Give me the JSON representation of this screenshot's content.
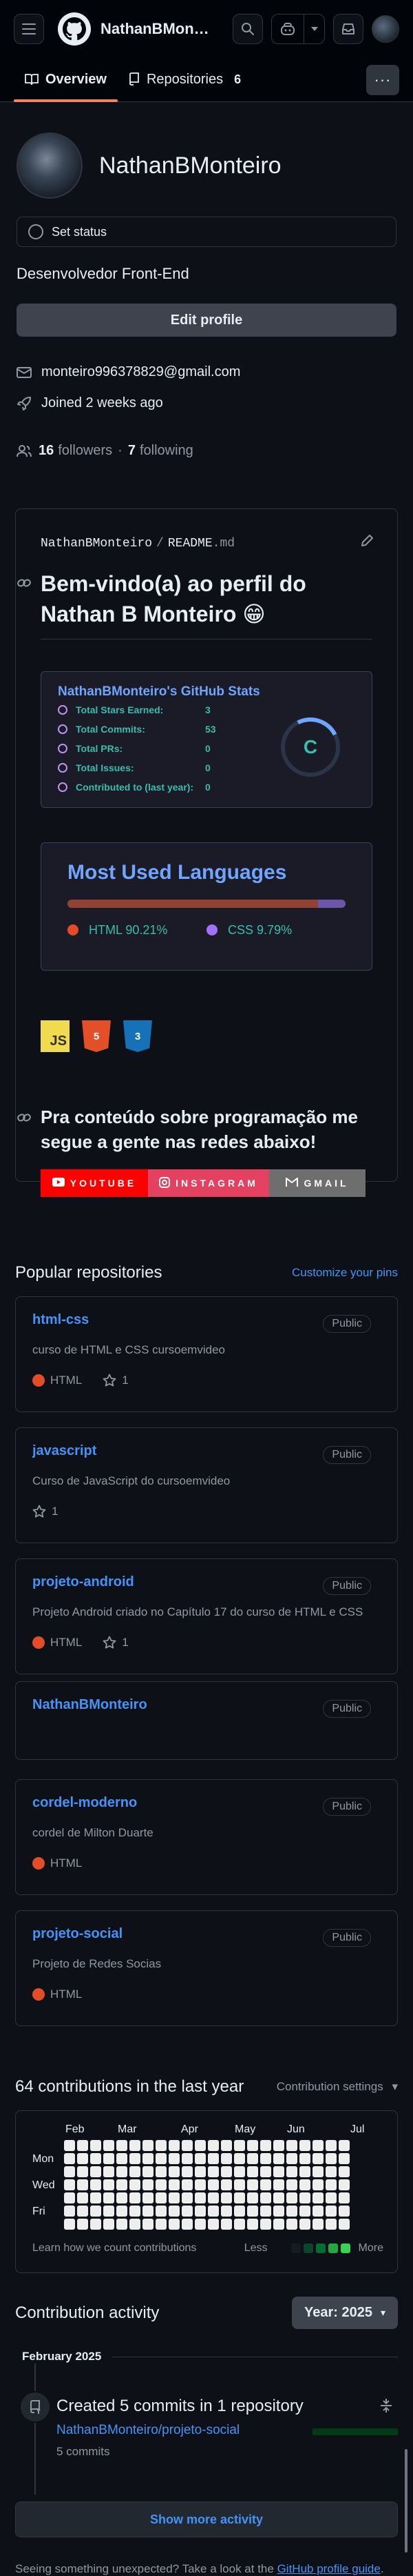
{
  "header": {
    "username": "NathanBMonteiro",
    "avatar_icon": "user-avatar"
  },
  "tabs": [
    {
      "label": "Overview"
    },
    {
      "label": "Repositories",
      "count": "6"
    }
  ],
  "profile": {
    "name": "NathanBMonteiro",
    "status_label": "Set status",
    "bio": "Desenvolvedor Front-End",
    "edit_label": "Edit profile",
    "email": "monteiro996378829@gmail.com",
    "joined": "Joined 2 weeks ago",
    "followers_count": "16",
    "followers_label": "followers",
    "separator": "·",
    "following_count": "7",
    "following_label": "following"
  },
  "readme": {
    "owner": "NathanBMonteiro",
    "slash": "/",
    "file": "README",
    "ext": ".md",
    "title": "Bem-vindo(a) ao perfil do Nathan B Monteiro 😁",
    "stats": {
      "title": "NathanBMonteiro's GitHub Stats",
      "rows": [
        {
          "label": "Total Stars Earned:",
          "value": "3"
        },
        {
          "label": "Total Commits:",
          "value": "53"
        },
        {
          "label": "Total PRs:",
          "value": "0"
        },
        {
          "label": "Total Issues:",
          "value": "0"
        },
        {
          "label": "Contributed to (last year):",
          "value": "0"
        }
      ],
      "rank": "C",
      "accent": "#70a5fd",
      "text_color": "#38bdae"
    },
    "languages": {
      "title": "Most Used Languages",
      "items": [
        {
          "name": "HTML",
          "percent": "90.21%",
          "value": 90.21,
          "color": "#e34c26"
        },
        {
          "name": "CSS",
          "percent": "9.79%",
          "value": 9.79,
          "color": "#a371f7"
        }
      ]
    },
    "tech": [
      {
        "label": "JS",
        "icon": "javascript-icon"
      },
      {
        "label": "5",
        "icon": "html5-icon"
      },
      {
        "label": "3",
        "icon": "css3-icon"
      }
    ],
    "social_title": "Pra conteúdo sobre programação me segue a gente nas redes abaixo!",
    "social": [
      {
        "label": "YOUTUBE",
        "icon": "youtube-icon"
      },
      {
        "label": "INSTAGRAM",
        "icon": "instagram-icon"
      },
      {
        "label": "GMAIL",
        "icon": "gmail-icon"
      }
    ]
  },
  "popular": {
    "title": "Popular repositories",
    "customize": "Customize your pins",
    "repos": [
      {
        "name": "html-css",
        "visibility": "Public",
        "desc": "curso de HTML e CSS cursoemvideo",
        "lang": "HTML",
        "stars": "1"
      },
      {
        "name": "javascript",
        "visibility": "Public",
        "desc": "Curso de JavaScript do cursoemvideo",
        "lang": "",
        "stars": "1"
      },
      {
        "name": "projeto-android",
        "visibility": "Public",
        "desc": "Projeto Android criado no Capítulo 17 do curso de HTML e CSS",
        "lang": "HTML",
        "stars": "1"
      },
      {
        "name": "NathanBMonteiro",
        "visibility": "Public",
        "desc": "",
        "lang": "",
        "stars": ""
      },
      {
        "name": "cordel-moderno",
        "visibility": "Public",
        "desc": "cordel de Milton Duarte",
        "lang": "HTML",
        "stars": ""
      },
      {
        "name": "projeto-social",
        "visibility": "Public",
        "desc": "Projeto de Redes Socias",
        "lang": "HTML",
        "stars": ""
      }
    ]
  },
  "contributions": {
    "title": "64 contributions in the last year",
    "settings": "Contribution settings",
    "months": [
      "Feb",
      "Mar",
      "Apr",
      "May",
      "Jun",
      "Jul"
    ],
    "days": [
      "Mon",
      "Wed",
      "Fri"
    ],
    "learn": "Learn how we count contributions",
    "less": "Less",
    "more": "More"
  },
  "activity": {
    "title": "Contribution activity",
    "year": "Year: 2025",
    "month": "February 2025",
    "event": "Created 5 commits in 1 repository",
    "repo": "NathanBMonteiro/projeto-social",
    "commits": "5 commits",
    "show_more": "Show more activity",
    "footer_prefix": "Seeing something unexpected? Take a look at the ",
    "footer_link": "GitHub profile guide",
    "footer_suffix": "."
  }
}
